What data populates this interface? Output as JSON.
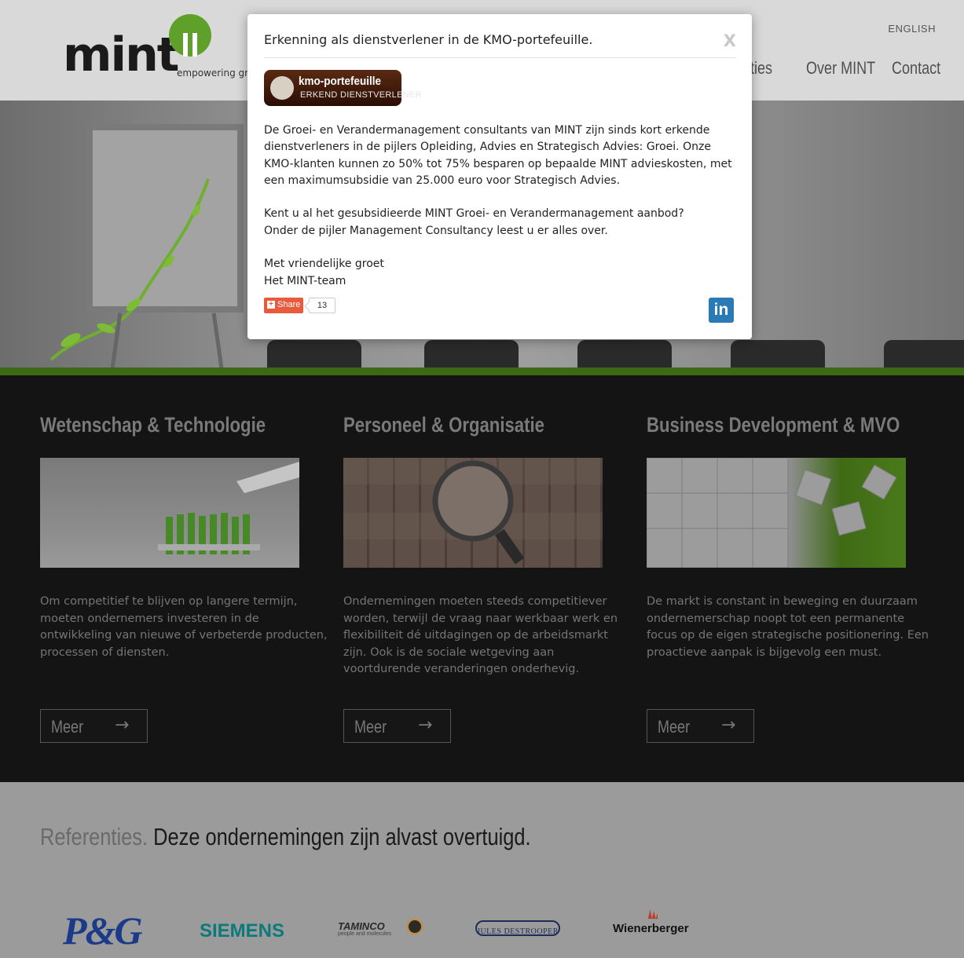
{
  "header": {
    "logo_text": "mint",
    "tagline": "empowering grov",
    "language_link": "ENGLISH",
    "nav": [
      {
        "label": "ties"
      },
      {
        "label": "Over MINT"
      },
      {
        "label": "Contact"
      }
    ]
  },
  "columns": [
    {
      "title": "Wetenschap & Technologie",
      "text": "Om competitief te blijven op langere termijn, moeten ondernemers investeren in de ontwikkeling van nieuwe of verbeterde producten, processen of diensten.",
      "button": "Meer"
    },
    {
      "title": "Personeel & Organisatie",
      "text": "Ondernemingen moeten steeds competitiever worden, terwijl de vraag naar werkbaar werk en flexibiliteit dé uitdagingen op de arbeidsmarkt zijn. Ook is de sociale wetgeving aan voortdurende veranderingen onderhevig.",
      "button": "Meer"
    },
    {
      "title": "Business Development & MVO",
      "text": "De markt is constant in beweging en duurzaam ondernemerschap noopt tot een permanente focus op de eigen strategische positionering. Een proactieve aanpak is bijgevolg een must.",
      "button": "Meer"
    }
  ],
  "references": {
    "title_gray": "Referenties.",
    "title_dark": "Deze ondernemingen zijn alvast overtuigd.",
    "logos": [
      {
        "name": "P&G",
        "color": "#1b3a8a"
      },
      {
        "name": "SIEMENS",
        "color": "#0c7a7a"
      },
      {
        "name": "TAMINCO",
        "subtitle": "people and molecules",
        "color": "#2a2a2a"
      },
      {
        "name": "JULES DESTROOPER",
        "color": "#1e2d55"
      },
      {
        "name": "Wienerberger",
        "color": "#111111"
      }
    ]
  },
  "modal": {
    "title": "Erkenning als dienstverlener in de KMO-portefeuille.",
    "close_label": "X",
    "badge_line1": "kmo-portefeuille",
    "badge_line2": "ERKEND DIENSTVERLENER",
    "paragraph1": "De Groei- en Verandermanagement consultants van MINT zijn sinds kort erkende dienstverleners in de pijlers Opleiding, Advies en Strategisch Advies: Groei. Onze KMO-klanten kunnen zo 50% tot 75% besparen op bepaalde MINT advieskosten, met een maximumsubsidie van 25.000 euro voor Strategisch Advies.",
    "paragraph2_line1": "Kent u al het gesubsidieerde MINT Groei- en Verandermanagement aanbod?",
    "paragraph2_line2": "Onder de pijler Management Consultancy leest u er alles over.",
    "closing_line1": "Met vriendelijke groet",
    "closing_line2": "Het MINT-team",
    "share_label": "Share",
    "share_count": "13",
    "linkedin_label": "in"
  },
  "colors": {
    "accent_green": "#5fa02a",
    "dark_bg": "#141414",
    "share_orange": "#e85a3c",
    "linkedin_blue": "#2a7ab5"
  }
}
